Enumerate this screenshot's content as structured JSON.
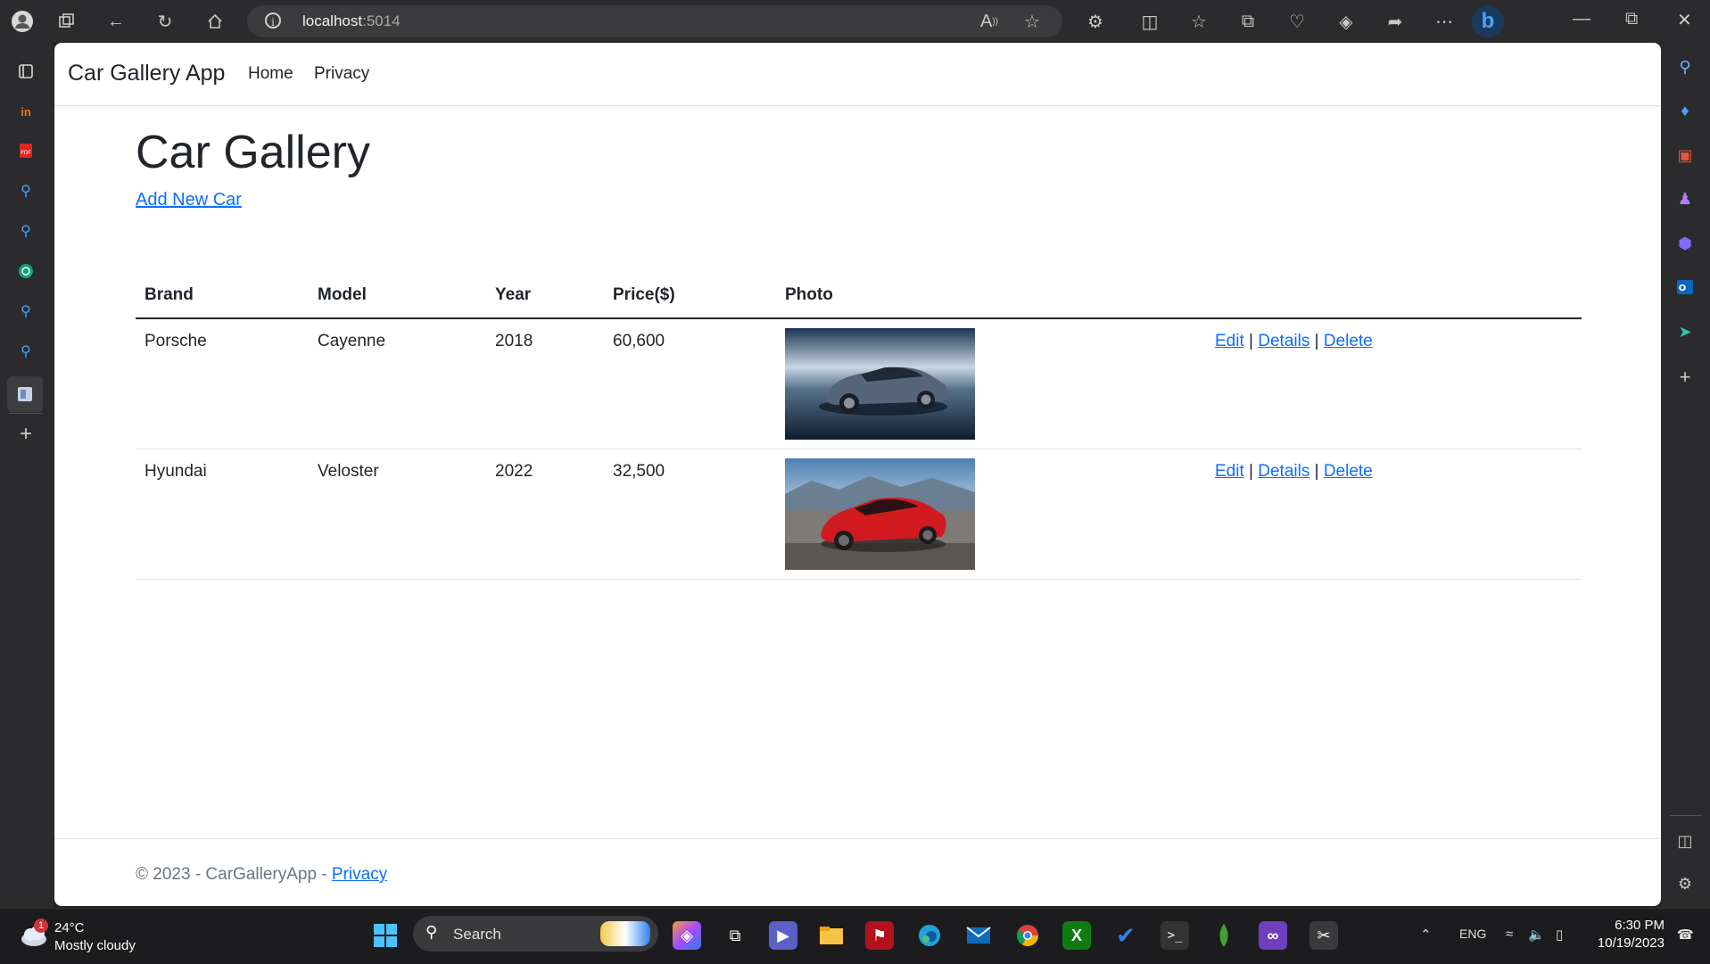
{
  "browser": {
    "url_host": "localhost",
    "url_port": ":5014"
  },
  "navbar": {
    "brand": "Car Gallery App",
    "links": [
      "Home",
      "Privacy"
    ]
  },
  "main": {
    "title": "Car Gallery",
    "add_link": "Add New Car",
    "table": {
      "headers": [
        "Brand",
        "Model",
        "Year",
        "Price($)",
        "Photo"
      ],
      "rows": [
        {
          "brand": "Porsche",
          "model": "Cayenne",
          "year": "2018",
          "price": "60,600",
          "photo": "porsche-cayenne-photo"
        },
        {
          "brand": "Hyundai",
          "model": "Veloster",
          "year": "2022",
          "price": "32,500",
          "photo": "hyundai-veloster-photo"
        }
      ],
      "actions": {
        "edit": "Edit",
        "details": "Details",
        "delete": "Delete",
        "sep": "|"
      }
    }
  },
  "footer": {
    "text": "© 2023 - CarGalleryApp - ",
    "privacy": "Privacy"
  },
  "taskbar": {
    "weather_temp": "24°C",
    "weather_desc": "Mostly cloudy",
    "weather_badge": "1",
    "search_label": "Search",
    "lang": "ENG",
    "time": "6:30 PM",
    "date": "10/19/2023"
  }
}
